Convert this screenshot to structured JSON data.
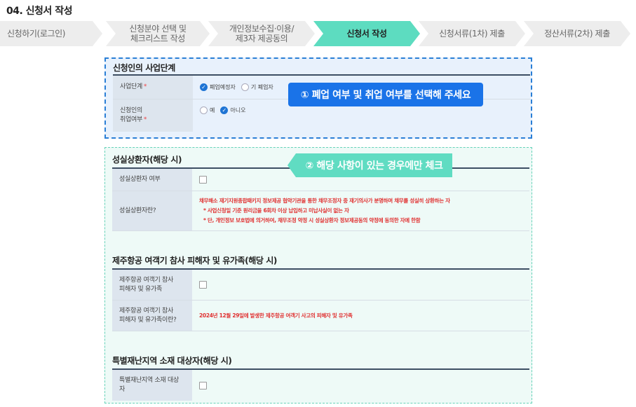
{
  "page_title": "04. 신청서 작성",
  "steps": [
    {
      "label": "신청하기(로그인)"
    },
    {
      "label": "신청분야 선택 및 체크리스트 작성"
    },
    {
      "label": "개인정보수집·이용/ 제3자 제공동의"
    },
    {
      "label": "신청서 작성"
    },
    {
      "label": "신청서류(1차) 제출"
    },
    {
      "label": "정산서류(2차) 제출"
    }
  ],
  "section1": {
    "title": "신청인의 사업단계",
    "business_stage_label": "사업단계",
    "business_stage_options": [
      "폐업예정자",
      "기 폐업자"
    ],
    "employment_label_1": "신청인의",
    "employment_label_2": "취업여부",
    "employment_options": [
      "예",
      "아니오"
    ],
    "required_mark": "*"
  },
  "callout1": "① 폐업 여부 및 취업 여부를 선택해 주세요",
  "callout2": "② 해당 사항이 있는 경우에만 체크",
  "section2": {
    "title": "성실상환자(해당 시)",
    "row1_label": "성실상환자 여부",
    "row2_label": "성실상환자란?",
    "row2_lines": [
      "채무해소 재기지원종합패키지 정보제공 협약기관을 통한 채무조정자 중 재기의사가 분명하며 채무를 성실히 상환하는 자",
      "* 사업신청일 기준 원리금을 6회차 이상 납입하고 미납사실이 없는 자",
      "* 단, 개인정보 보호법에 의거하여, 채무조정 약정 시 성실상환자 정보제공동의 약정에 동의한 자에 한함"
    ]
  },
  "section3": {
    "title": "제주항공 여객기 참사 피해자 및 유가족(해당 시)",
    "row1_label_1": "제주항공 여객기 참사",
    "row1_label_2": "피해자 및 유가족",
    "row2_label_1": "제주항공 여객기 참사",
    "row2_label_2": "피해자 및 유가족이란?",
    "row2_text": "2024년 12월 29일에 발생한 제주항공 여객기 사고의 피해자 및 유가족"
  },
  "section4": {
    "title": "특별재난지역 소재 대상자(해당 시)",
    "row1_label_1": "특별재난지역 소재 대상",
    "row1_label_2": "자"
  },
  "colors": {
    "active_step": "#5ddcc0",
    "blue_box_border": "#2b7fd6",
    "teal_box_border": "#66d2b8",
    "callout_blue": "#1a73e8",
    "callout_teal": "#60dcc2",
    "red_text": "#e03131"
  }
}
